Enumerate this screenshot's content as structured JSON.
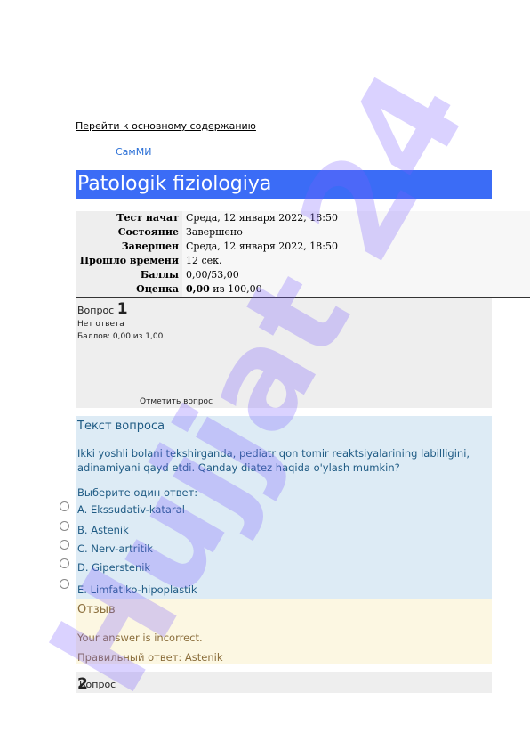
{
  "skip_link": "Перейти к основному содержанию",
  "site_name": "СамМИ",
  "course_title": "Patologik fiziologiya",
  "summary": [
    {
      "label": "Тест начат",
      "value": "Среда, 12 января 2022, 18:50"
    },
    {
      "label": "Состояние",
      "value": "Завершено"
    },
    {
      "label": "Завершен",
      "value": "Среда, 12 января 2022, 18:50"
    },
    {
      "label": "Прошло времени",
      "value": "12 сек."
    },
    {
      "label": "Баллы",
      "value": "0,00/53,00"
    },
    {
      "label": "Оценка",
      "value_bold": "0,00",
      "value_rest": " из 100,00"
    }
  ],
  "question1": {
    "label": "Вопрос",
    "number": "1",
    "state": "Нет ответа",
    "grade": "Баллов: 0,00 из 1,00",
    "flag": "Отметить вопрос",
    "text_heading": "Текст вопроса",
    "text": "Ikki yoshli bolani tekshirganda, pediatr qon tomir reaktsiyalarining labilligini, adinamiyani qayd etdi. Qanday diatez haqida o'ylash mumkin?",
    "prompt": "Выберите один ответ:",
    "options": [
      "A. Ekssudativ-kataral",
      "B. Astenik",
      "C. Nerv-artritik",
      "D. Giperstenik",
      "E. Limfatiko-hipoplastik"
    ]
  },
  "feedback": {
    "heading": "Отзыв",
    "incorrect": "Your answer is incorrect.",
    "correct": "Правильный ответ: Astenik"
  },
  "question2": {
    "label": "Вопрос",
    "number": "2"
  },
  "watermark": {
    "text": "Hujjat 24",
    "color": "#7a5cff"
  },
  "colors": {
    "banner": "#3b6cf6",
    "question_bg": "#ddebf5",
    "feedback_bg": "#fcf7e2"
  }
}
